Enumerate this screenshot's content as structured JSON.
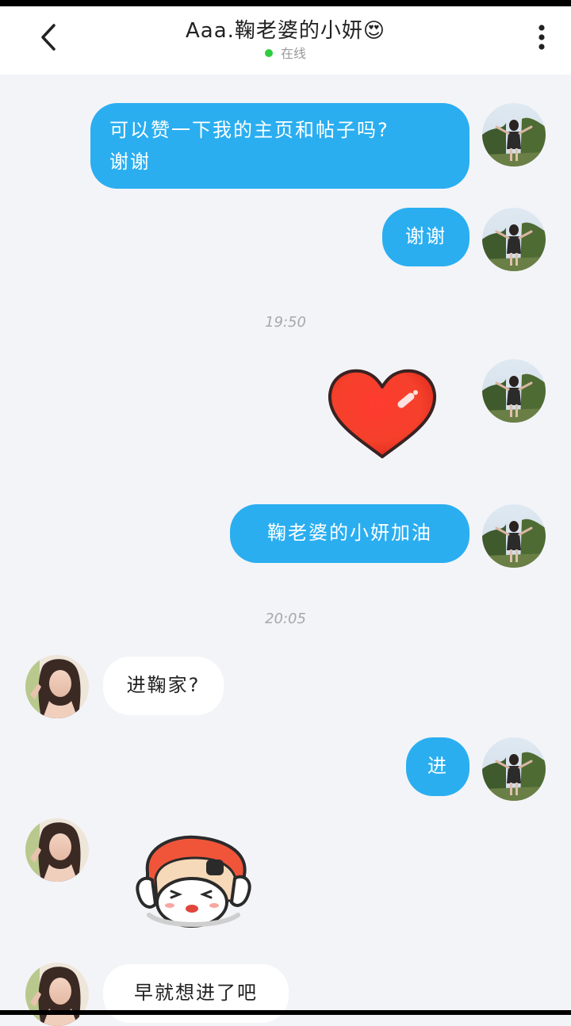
{
  "header": {
    "title": "Aaa.鞠老婆的小妍",
    "title_emoji": "😍",
    "status": "在线",
    "status_color": "#2ecc40"
  },
  "messages": [
    {
      "side": "me",
      "text_line1": "可以赞一下我的主页和帖子吗?",
      "text_line2": "谢谢"
    },
    {
      "side": "me",
      "text": "谢谢"
    },
    {
      "kind": "time",
      "text": "19:50"
    },
    {
      "side": "me",
      "kind": "sticker",
      "sticker": "heart-sticker"
    },
    {
      "side": "me",
      "text": "鞠老婆的小妍加油"
    },
    {
      "kind": "time",
      "text": "20:05"
    },
    {
      "side": "them",
      "text": "进鞠家?"
    },
    {
      "side": "me",
      "text": "进"
    },
    {
      "side": "them",
      "kind": "sticker",
      "sticker": "cartoon-girl-sticker"
    },
    {
      "side": "them",
      "text": "早就想进了吧"
    }
  ],
  "colors": {
    "my_bubble": "#2aaef0",
    "their_bubble": "#ffffff",
    "background": "#f3f4f8"
  },
  "icons": {
    "back": "chevron-left-icon",
    "more": "more-vertical-icon"
  }
}
